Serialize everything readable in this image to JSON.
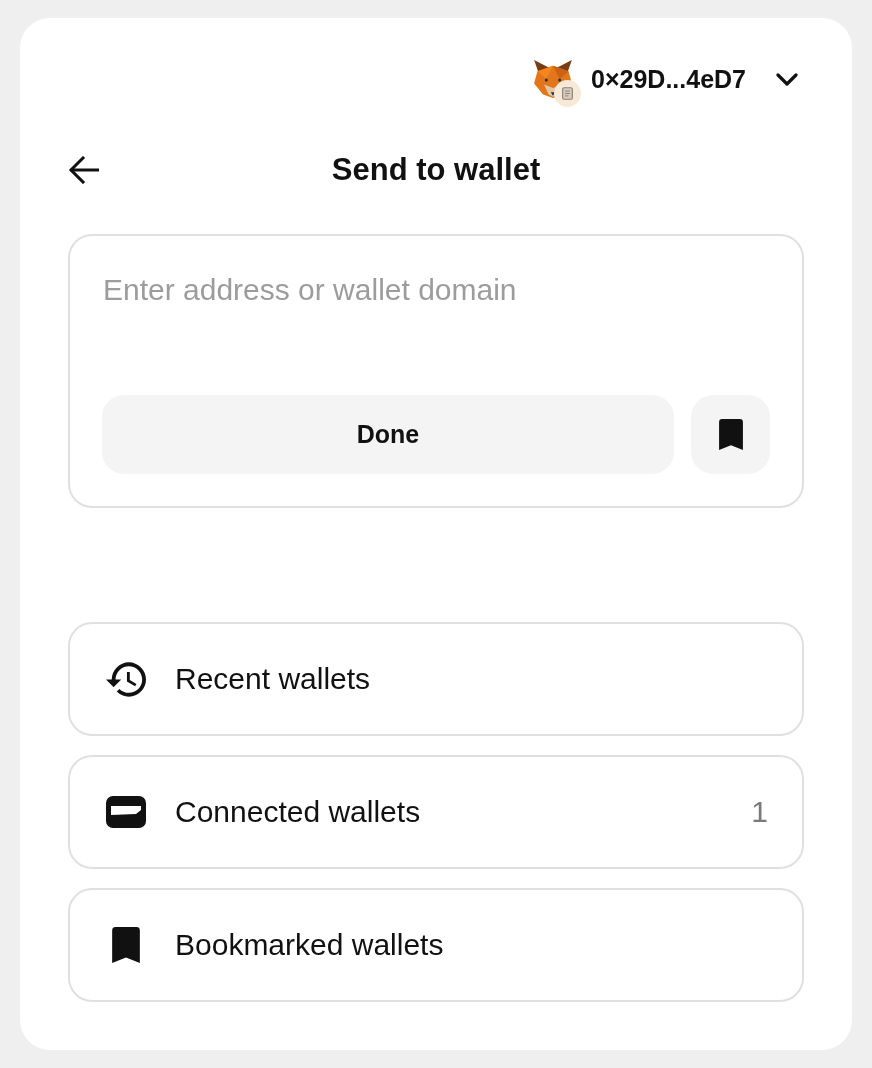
{
  "header": {
    "account": {
      "address": "0×29D...4eD7"
    }
  },
  "title_bar": {
    "title": "Send to wallet"
  },
  "address_input": {
    "placeholder": "Enter address or wallet domain",
    "done_button": "Done"
  },
  "wallet_lists": [
    {
      "kind": "recent",
      "label": "Recent wallets"
    },
    {
      "kind": "connected",
      "label": "Connected wallets",
      "count": "1"
    },
    {
      "kind": "bookmarked",
      "label": "Bookmarked wallets"
    }
  ]
}
